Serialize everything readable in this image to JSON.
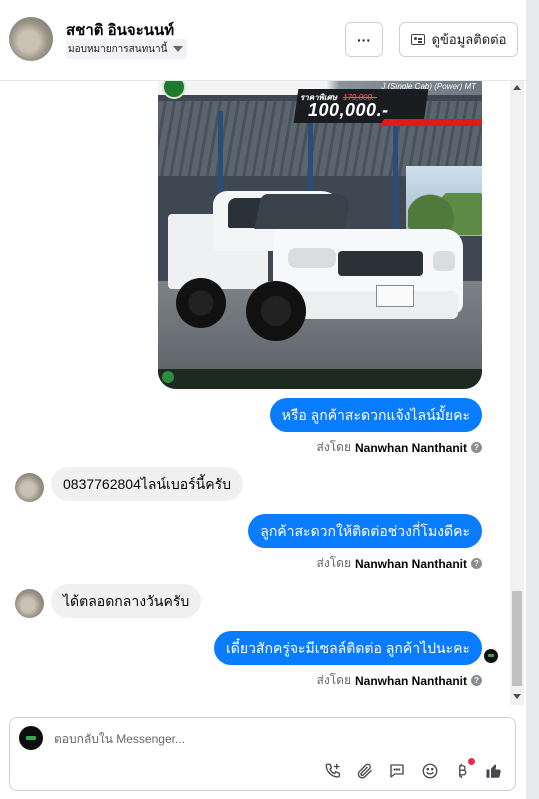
{
  "header": {
    "contact_name": "สชาติ อินจะนนท์",
    "assign_label": "มอบหมายการสนทนานี้",
    "more_label": "···",
    "view_contact_label": "ดูข้อมูลติดต่อ"
  },
  "ad_image": {
    "model": "J (Single Cab) (Power) MT",
    "price_prefix": "ราคาพิเศษ",
    "price_old": "179,000.-",
    "price_new": "100,000.-"
  },
  "messages": [
    {
      "direction": "out",
      "text": "หรือ ลูกค้าสะดวกแจ้งไลน์มั้ยคะ",
      "sent_by_prefix": "ส่งโดย",
      "sender": "Nanwhan Nanthanit"
    },
    {
      "direction": "in",
      "text": "0837762804ไลน์เบอร์นี้ครับ"
    },
    {
      "direction": "out",
      "text": "ลูกค้าสะดวกให้ติดต่อช่วงกี่โมงดีคะ",
      "sent_by_prefix": "ส่งโดย",
      "sender": "Nanwhan Nanthanit"
    },
    {
      "direction": "in",
      "text": "ได้ตลอดกลางวันครับ"
    },
    {
      "direction": "out",
      "text": "เดี๋ยวสักครู่จะมีเซลล์ติดต่อ ลูกค้าไปนะคะ",
      "sent_by_prefix": "ส่งโดย",
      "sender": "Nanwhan Nanthanit"
    }
  ],
  "composer": {
    "placeholder": "ตอบกลับใน Messenger..."
  },
  "toolbar_icons": [
    "call-icon",
    "attachment-icon",
    "saved-replies-icon",
    "emoji-icon",
    "payment-icon",
    "like-icon"
  ],
  "colors": {
    "outgoing_bubble": "#0a7cff",
    "incoming_bubble": "#f0f0f0",
    "notification_dot": "#f02849",
    "like_icon": "#444950"
  }
}
